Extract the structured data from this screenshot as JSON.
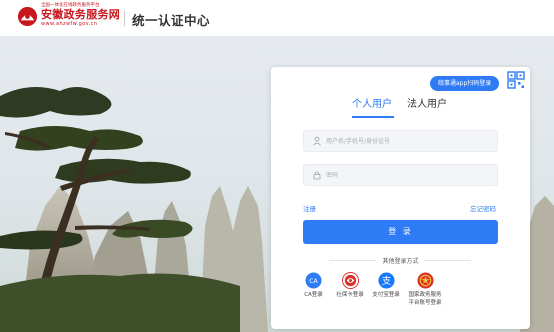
{
  "header": {
    "brand_small": "全国一体化在线政务服务平台",
    "brand_name": "安徽政务服务网",
    "brand_url": "www.ahzwfw.gov.cn",
    "title": "统一认证中心"
  },
  "login": {
    "app_tag": "皖事通app扫码登录",
    "tabs": [
      {
        "label": "个人用户",
        "active": true
      },
      {
        "label": "法人用户",
        "active": false
      }
    ],
    "username_placeholder": "用户名/手机号/身份证号",
    "password_placeholder": "密码",
    "register_link": "注册",
    "forgot_link": "忘记密码",
    "login_button": "登 录",
    "other_methods_label": "其他登录方式",
    "methods": [
      {
        "label": "CA登录",
        "icon": "ca-icon",
        "color": "#2f7bf5"
      },
      {
        "label": "社保卡登录",
        "icon": "social-security-card-icon",
        "color": "#d9322b"
      },
      {
        "label": "支付宝登录",
        "icon": "alipay-icon",
        "color": "#1677ff"
      },
      {
        "label_line1": "国家政务服务",
        "label_line2": "平台账号登录",
        "icon": "national-emblem-icon",
        "color": "#d9322b"
      }
    ]
  },
  "colors": {
    "brand_red": "#c8161d",
    "accent_blue": "#2f7bf5"
  }
}
